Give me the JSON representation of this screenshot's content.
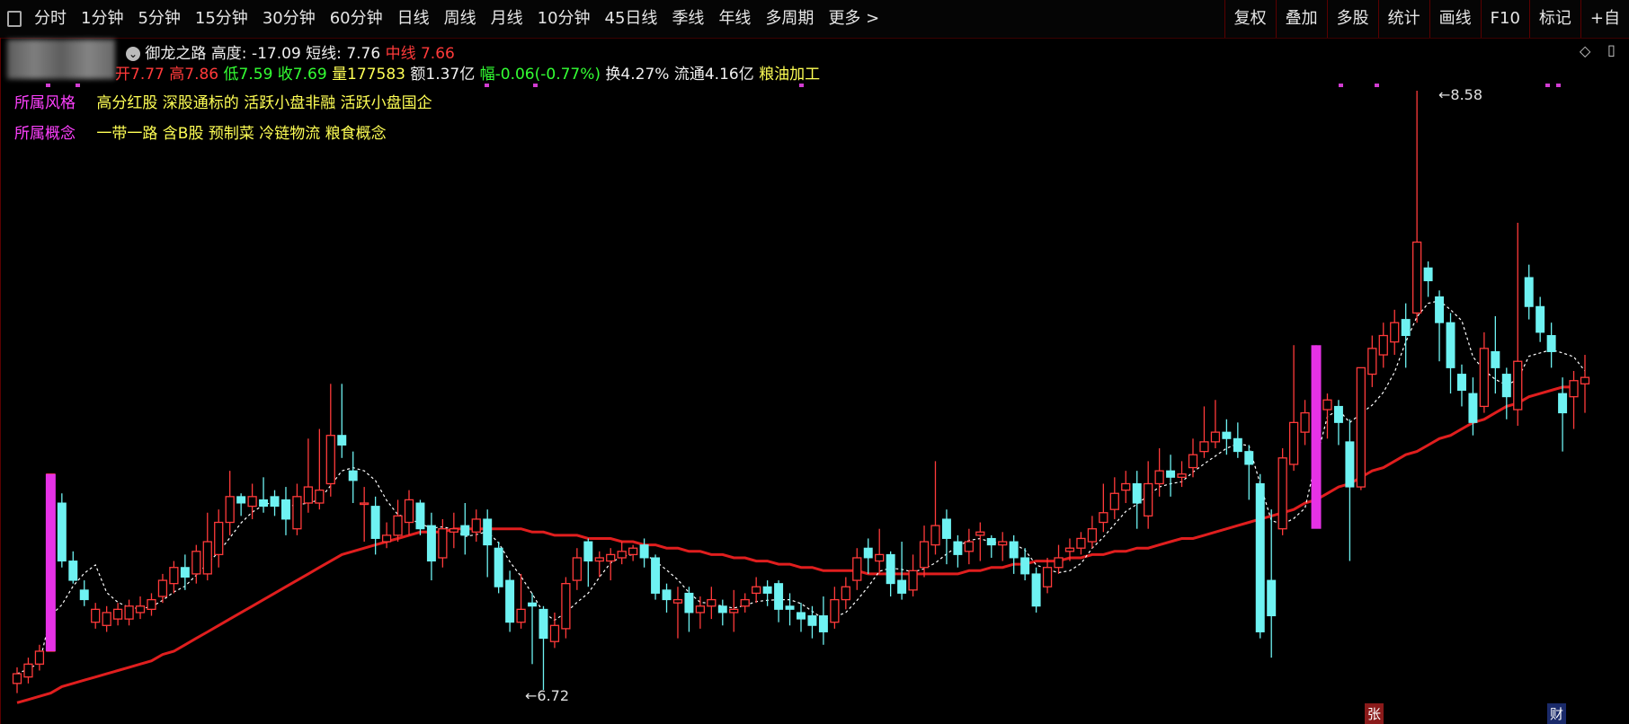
{
  "toolbar": {
    "periods": [
      "分时",
      "1分钟",
      "5分钟",
      "15分钟",
      "30分钟",
      "60分钟",
      "日线",
      "周线",
      "月线",
      "10分钟",
      "45日线",
      "季线",
      "年线",
      "多周期",
      "更多 >"
    ],
    "actions": [
      "复权",
      "叠加",
      "多股",
      "统计",
      "画线",
      "F10",
      "标记",
      "+自"
    ]
  },
  "header": {
    "stock_name": "御龙之路",
    "height_label": "高度:",
    "height_value": "-17.09",
    "short_line_label": "短线:",
    "short_line_value": "7.76",
    "mid_line_label": "中线",
    "mid_line_value": "7.66",
    "open": "开7.77",
    "high": "高7.86",
    "low": "低7.59",
    "close": "收7.69",
    "volume": "量177583",
    "amount": "额1.37亿",
    "change": "幅-0.06(-0.77%)",
    "turnover": "换4.27%",
    "float": "流通4.16亿",
    "industry": "粮油加工"
  },
  "style_row": {
    "label": "所属风格",
    "value": "高分红股 深股通标的 活跃小盘非融 活跃小盘国企"
  },
  "concept_row": {
    "label": "所属概念",
    "value": "一带一路 含B股 预制菜 冷链物流 粮食概念"
  },
  "annotations": {
    "high_label": "8.58",
    "low_label": "6.72",
    "tag_zhang": "张",
    "tag_cai": "财"
  },
  "colors": {
    "up": "#ff3a3a",
    "down": "#6ef2f2",
    "ma_long": "#e01e1e",
    "ma_short": "#ffffff",
    "limit_up": "#e632e6"
  },
  "chart_data": {
    "type": "candlestick",
    "y_high": 8.58,
    "y_low": 6.72,
    "candles": [
      [
        6.74,
        6.77,
        6.71,
        6.79
      ],
      [
        6.76,
        6.8,
        6.74,
        6.82
      ],
      [
        6.8,
        6.84,
        6.78,
        6.86
      ],
      [
        6.84,
        7.39,
        6.84,
        7.39
      ],
      [
        7.3,
        7.12,
        7.1,
        7.33
      ],
      [
        7.12,
        7.06,
        7.05,
        7.15
      ],
      [
        7.03,
        7.0,
        6.98,
        7.06
      ],
      [
        6.93,
        6.97,
        6.91,
        6.99
      ],
      [
        6.92,
        6.96,
        6.9,
        6.98
      ],
      [
        6.94,
        6.97,
        6.92,
        6.99
      ],
      [
        6.94,
        6.98,
        6.92,
        7.0
      ],
      [
        6.96,
        6.98,
        6.94,
        7.01
      ],
      [
        6.97,
        7.0,
        6.95,
        7.02
      ],
      [
        7.01,
        7.06,
        6.99,
        7.08
      ],
      [
        7.05,
        7.1,
        7.02,
        7.12
      ],
      [
        7.1,
        7.07,
        7.03,
        7.14
      ],
      [
        7.08,
        7.15,
        7.05,
        7.17
      ],
      [
        7.08,
        7.18,
        7.06,
        7.27
      ],
      [
        7.14,
        7.24,
        7.1,
        7.28
      ],
      [
        7.24,
        7.32,
        7.2,
        7.4
      ],
      [
        7.32,
        7.3,
        7.26,
        7.33
      ],
      [
        7.29,
        7.32,
        7.25,
        7.36
      ],
      [
        7.31,
        7.29,
        7.27,
        7.38
      ],
      [
        7.32,
        7.29,
        7.26,
        7.34
      ],
      [
        7.31,
        7.25,
        7.2,
        7.35
      ],
      [
        7.22,
        7.32,
        7.2,
        7.36
      ],
      [
        7.3,
        7.35,
        7.27,
        7.5
      ],
      [
        7.3,
        7.34,
        7.28,
        7.53
      ],
      [
        7.36,
        7.51,
        7.32,
        7.67
      ],
      [
        7.51,
        7.48,
        7.44,
        7.67
      ],
      [
        7.4,
        7.37,
        7.3,
        7.46
      ],
      [
        7.3,
        7.3,
        7.18,
        7.35
      ],
      [
        7.29,
        7.19,
        7.14,
        7.32
      ],
      [
        7.18,
        7.2,
        7.16,
        7.24
      ],
      [
        7.2,
        7.26,
        7.18,
        7.31
      ],
      [
        7.24,
        7.31,
        7.2,
        7.34
      ],
      [
        7.3,
        7.22,
        7.2,
        7.31
      ],
      [
        7.23,
        7.12,
        7.06,
        7.27
      ],
      [
        7.13,
        7.22,
        7.1,
        7.25
      ],
      [
        7.21,
        7.22,
        7.16,
        7.27
      ],
      [
        7.23,
        7.2,
        7.14,
        7.3
      ],
      [
        7.21,
        7.25,
        7.18,
        7.28
      ],
      [
        7.25,
        7.17,
        7.07,
        7.28
      ],
      [
        7.16,
        7.04,
        7.02,
        7.18
      ],
      [
        7.06,
        6.93,
        6.9,
        7.09
      ],
      [
        6.93,
        6.97,
        6.91,
        7.08
      ],
      [
        6.99,
        6.98,
        6.8,
        7.02
      ],
      [
        6.97,
        6.88,
        6.72,
        6.98
      ],
      [
        6.87,
        6.92,
        6.85,
        6.96
      ],
      [
        6.91,
        7.05,
        6.88,
        7.07
      ],
      [
        7.06,
        7.13,
        7.03,
        7.16
      ],
      [
        7.18,
        7.12,
        7.04,
        7.19
      ],
      [
        7.12,
        7.13,
        7.07,
        7.15
      ],
      [
        7.12,
        7.14,
        7.06,
        7.16
      ],
      [
        7.13,
        7.15,
        7.11,
        7.18
      ],
      [
        7.14,
        7.16,
        7.12,
        7.17
      ],
      [
        7.17,
        7.13,
        7.1,
        7.19
      ],
      [
        7.13,
        7.02,
        7.0,
        7.14
      ],
      [
        7.03,
        7.0,
        6.96,
        7.05
      ],
      [
        6.99,
        7.0,
        6.88,
        7.04
      ],
      [
        7.02,
        6.96,
        6.9,
        7.04
      ],
      [
        6.96,
        6.98,
        6.91,
        7.01
      ],
      [
        6.98,
        7.0,
        6.94,
        7.04
      ],
      [
        6.98,
        6.96,
        6.92,
        7.0
      ],
      [
        6.96,
        6.97,
        6.9,
        7.03
      ],
      [
        6.98,
        7.0,
        6.96,
        7.02
      ],
      [
        7.02,
        7.04,
        6.99,
        7.07
      ],
      [
        7.04,
        7.02,
        6.98,
        7.06
      ],
      [
        7.05,
        6.97,
        6.93,
        7.06
      ],
      [
        6.98,
        6.97,
        6.92,
        7.02
      ],
      [
        6.96,
        6.94,
        6.9,
        6.99
      ],
      [
        6.95,
        6.92,
        6.88,
        6.98
      ],
      [
        6.95,
        6.9,
        6.86,
        7.01
      ],
      [
        6.93,
        7.0,
        6.91,
        7.04
      ],
      [
        7.0,
        7.04,
        6.97,
        7.07
      ],
      [
        7.06,
        7.13,
        7.03,
        7.16
      ],
      [
        7.16,
        7.13,
        7.08,
        7.19
      ],
      [
        7.12,
        7.14,
        7.08,
        7.22
      ],
      [
        7.14,
        7.05,
        7.01,
        7.15
      ],
      [
        7.06,
        7.02,
        7.0,
        7.18
      ],
      [
        7.03,
        7.09,
        7.01,
        7.14
      ],
      [
        7.1,
        7.18,
        7.07,
        7.23
      ],
      [
        7.17,
        7.23,
        7.14,
        7.43
      ],
      [
        7.25,
        7.19,
        7.11,
        7.28
      ],
      [
        7.18,
        7.14,
        7.1,
        7.2
      ],
      [
        7.15,
        7.18,
        7.11,
        7.22
      ],
      [
        7.2,
        7.21,
        7.12,
        7.24
      ],
      [
        7.19,
        7.17,
        7.13,
        7.2
      ],
      [
        7.17,
        7.18,
        7.12,
        7.21
      ],
      [
        7.18,
        7.13,
        7.08,
        7.2
      ],
      [
        7.13,
        7.08,
        7.06,
        7.16
      ],
      [
        7.08,
        6.98,
        6.96,
        7.1
      ],
      [
        7.04,
        7.1,
        7.02,
        7.13
      ],
      [
        7.1,
        7.13,
        7.08,
        7.17
      ],
      [
        7.15,
        7.16,
        7.12,
        7.19
      ],
      [
        7.16,
        7.19,
        7.14,
        7.21
      ],
      [
        7.18,
        7.22,
        7.16,
        7.26
      ],
      [
        7.24,
        7.27,
        7.21,
        7.36
      ],
      [
        7.28,
        7.33,
        7.25,
        7.38
      ],
      [
        7.34,
        7.36,
        7.3,
        7.4
      ],
      [
        7.36,
        7.3,
        7.22,
        7.4
      ],
      [
        7.26,
        7.36,
        7.22,
        7.43
      ],
      [
        7.36,
        7.4,
        7.32,
        7.47
      ],
      [
        7.4,
        7.38,
        7.32,
        7.45
      ],
      [
        7.38,
        7.39,
        7.35,
        7.43
      ],
      [
        7.41,
        7.45,
        7.38,
        7.5
      ],
      [
        7.46,
        7.49,
        7.44,
        7.6
      ],
      [
        7.49,
        7.52,
        7.47,
        7.62
      ],
      [
        7.52,
        7.5,
        7.45,
        7.56
      ],
      [
        7.5,
        7.46,
        7.44,
        7.55
      ],
      [
        7.46,
        7.42,
        7.31,
        7.48
      ],
      [
        7.36,
        6.9,
        6.88,
        7.39
      ],
      [
        7.06,
        6.95,
        6.82,
        7.28
      ],
      [
        7.22,
        7.44,
        7.2,
        7.47
      ],
      [
        7.42,
        7.55,
        7.4,
        7.79
      ],
      [
        7.52,
        7.58,
        7.48,
        7.62
      ],
      [
        7.6,
        7.65,
        7.56,
        7.79
      ],
      [
        7.59,
        7.62,
        7.5,
        7.64
      ],
      [
        7.6,
        7.55,
        7.48,
        7.62
      ],
      [
        7.49,
        7.35,
        7.12,
        7.56
      ],
      [
        7.35,
        7.72,
        7.34,
        7.72
      ],
      [
        7.7,
        7.78,
        7.66,
        7.82
      ],
      [
        7.76,
        7.82,
        7.72,
        7.86
      ],
      [
        7.8,
        7.86,
        7.76,
        7.9
      ],
      [
        7.87,
        7.82,
        7.72,
        7.92
      ],
      [
        7.89,
        8.11,
        7.86,
        8.58
      ],
      [
        8.03,
        7.99,
        7.94,
        8.05
      ],
      [
        7.94,
        7.86,
        7.74,
        7.96
      ],
      [
        7.86,
        7.72,
        7.64,
        7.89
      ],
      [
        7.7,
        7.65,
        7.6,
        7.73
      ],
      [
        7.64,
        7.55,
        7.51,
        7.69
      ],
      [
        7.6,
        7.78,
        7.58,
        7.83
      ],
      [
        7.77,
        7.72,
        7.64,
        7.88
      ],
      [
        7.7,
        7.63,
        7.56,
        7.72
      ],
      [
        7.59,
        7.74,
        7.54,
        8.17
      ],
      [
        8.0,
        7.91,
        7.87,
        8.04
      ],
      [
        7.91,
        7.83,
        7.8,
        7.94
      ],
      [
        7.82,
        7.77,
        7.72,
        7.86
      ],
      [
        7.64,
        7.58,
        7.46,
        7.69
      ],
      [
        7.63,
        7.68,
        7.53,
        7.71
      ],
      [
        7.67,
        7.69,
        7.58,
        7.76
      ]
    ],
    "limit_up_bars": [
      [
        3,
        6.84,
        7.39
      ],
      [
        116,
        7.22,
        7.79
      ]
    ],
    "ma_long": [
      6.68,
      6.69,
      6.7,
      6.71,
      6.73,
      6.74,
      6.75,
      6.76,
      6.77,
      6.78,
      6.79,
      6.8,
      6.81,
      6.83,
      6.84,
      6.86,
      6.88,
      6.9,
      6.92,
      6.94,
      6.96,
      6.98,
      7.0,
      7.02,
      7.04,
      7.06,
      7.08,
      7.1,
      7.12,
      7.14,
      7.15,
      7.16,
      7.17,
      7.18,
      7.19,
      7.2,
      7.21,
      7.21,
      7.21,
      7.22,
      7.22,
      7.22,
      7.22,
      7.22,
      7.22,
      7.22,
      7.21,
      7.21,
      7.2,
      7.2,
      7.2,
      7.19,
      7.19,
      7.19,
      7.18,
      7.18,
      7.17,
      7.17,
      7.16,
      7.16,
      7.15,
      7.15,
      7.14,
      7.14,
      7.13,
      7.13,
      7.12,
      7.12,
      7.11,
      7.11,
      7.1,
      7.1,
      7.09,
      7.09,
      7.09,
      7.09,
      7.08,
      7.08,
      7.08,
      7.08,
      7.08,
      7.08,
      7.08,
      7.08,
      7.08,
      7.09,
      7.09,
      7.1,
      7.1,
      7.11,
      7.11,
      7.12,
      7.12,
      7.12,
      7.13,
      7.13,
      7.14,
      7.14,
      7.15,
      7.15,
      7.16,
      7.16,
      7.17,
      7.18,
      7.19,
      7.19,
      7.2,
      7.21,
      7.22,
      7.23,
      7.24,
      7.25,
      7.26,
      7.27,
      7.28,
      7.3,
      7.31,
      7.33,
      7.35,
      7.36,
      7.38,
      7.4,
      7.41,
      7.43,
      7.45,
      7.46,
      7.48,
      7.5,
      7.51,
      7.53,
      7.55,
      7.56,
      7.58,
      7.6,
      7.61,
      7.63,
      7.64,
      7.65,
      7.66,
      7.66
    ]
  }
}
